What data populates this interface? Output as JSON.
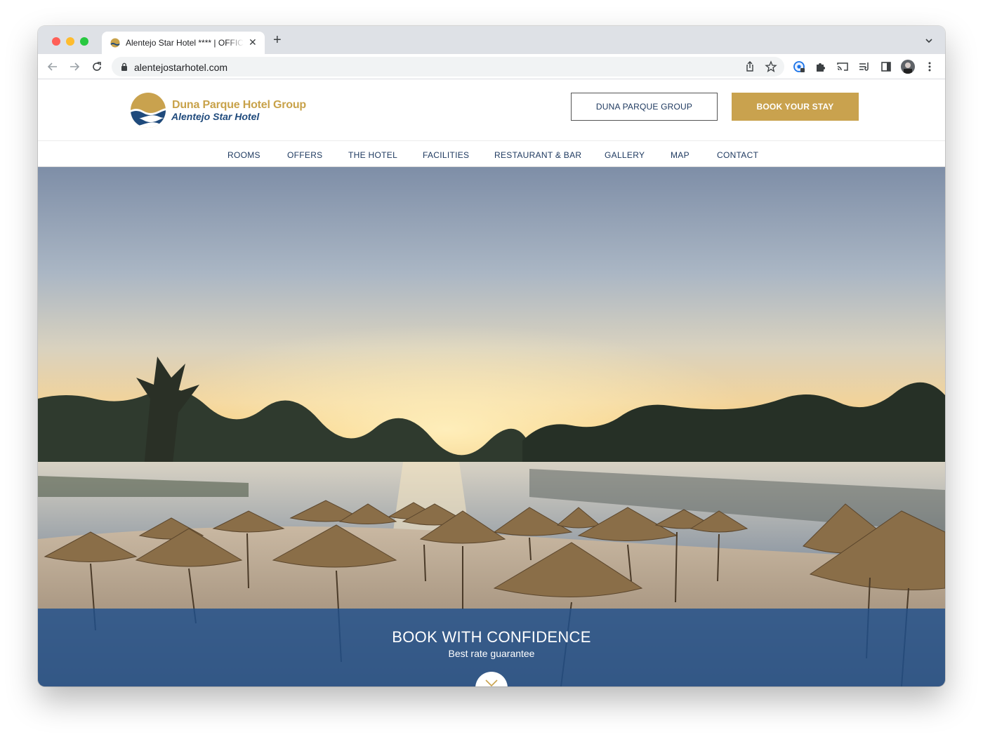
{
  "browser": {
    "tab": {
      "title": "Alentejo Star Hotel **** | OFFICIAL SITE",
      "close_glyph": "✕"
    },
    "newtab_glyph": "+",
    "url": "alentejostarhotel.com"
  },
  "header": {
    "logo_line1": "Duna Parque Hotel Group",
    "logo_line2": "Alentejo Star Hotel",
    "group_button": "DUNA PARQUE GROUP",
    "book_button": "BOOK YOUR STAY"
  },
  "nav": {
    "items": [
      {
        "label": "ROOMS"
      },
      {
        "label": "OFFERS"
      },
      {
        "label": "THE HOTEL"
      },
      {
        "label": "FACILITIES"
      },
      {
        "label": "RESTAURANT & BAR"
      },
      {
        "label": "GALLERY"
      },
      {
        "label": "MAP"
      },
      {
        "label": "CONTACT"
      }
    ]
  },
  "hero": {
    "title": "BOOK WITH CONFIDENCE",
    "subtitle": "Best rate guarantee"
  },
  "colors": {
    "brand_gold": "#c9a24e",
    "brand_blue": "#1f3a60",
    "banner_blue": "#1f4f8c"
  },
  "icons": {
    "back": "arrow-left-icon",
    "forward": "arrow-right-icon",
    "reload": "reload-icon",
    "lock": "lock-icon",
    "share": "share-icon",
    "bookmark": "star-icon",
    "extensions": "puzzle-icon",
    "cast": "cast-icon",
    "reading_list": "reading-list-icon",
    "side_panel": "side-panel-icon",
    "menu": "kebab-menu-icon",
    "scroll": "chevron-down-icon"
  }
}
